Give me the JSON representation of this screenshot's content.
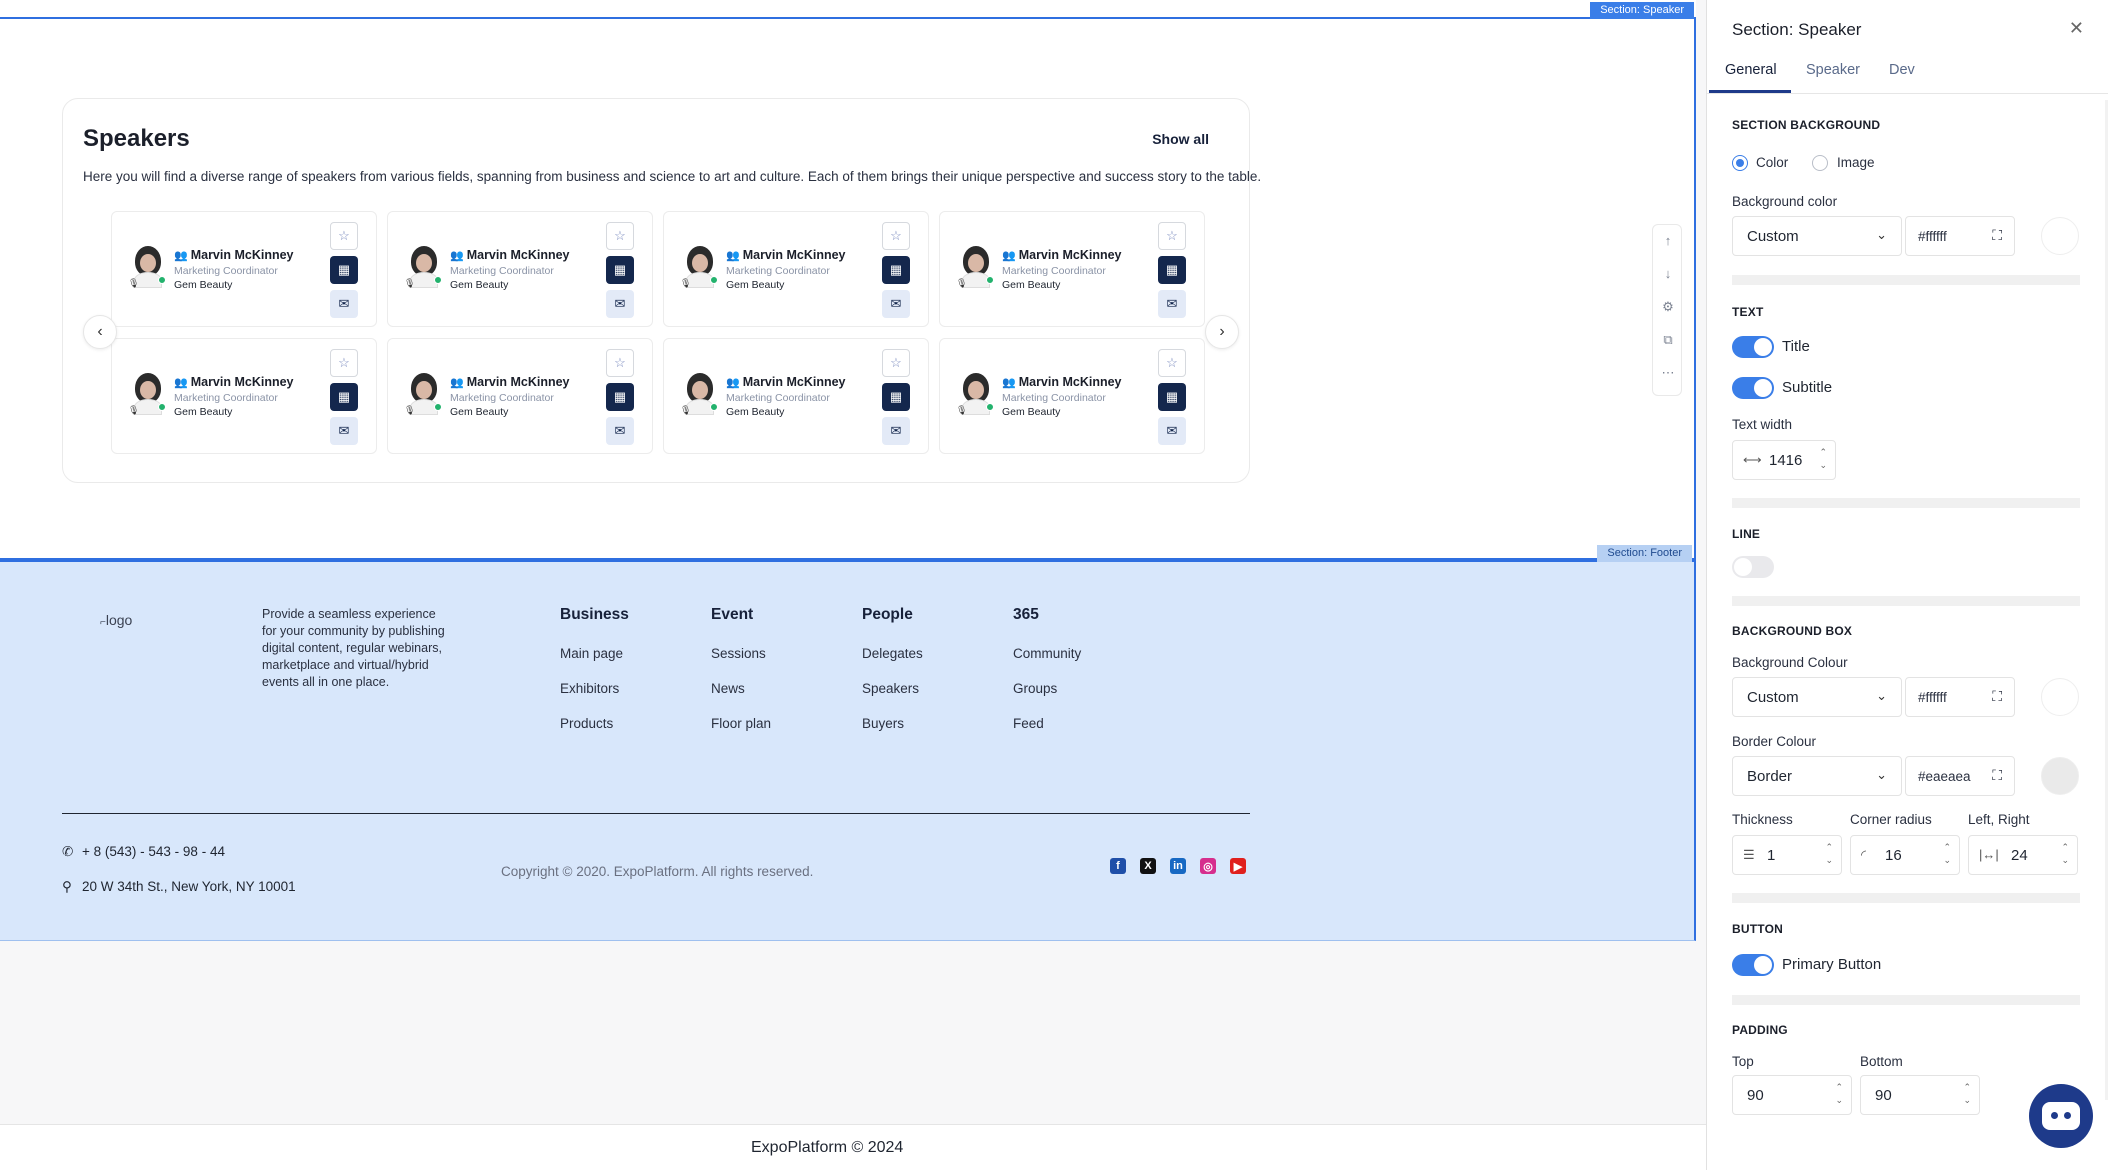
{
  "speakers_section": {
    "tag": "Section: Speaker",
    "title": "Speakers",
    "show_all": "Show all",
    "subtitle": "Here you will find a diverse range of speakers from various fields, spanning from business and science to art and culture. Each of them brings their unique perspective and success story to the table.",
    "cards": [
      {
        "name": "Marvin McKinney",
        "role": "Marketing Coordinator",
        "company": "Gem Beauty"
      },
      {
        "name": "Marvin McKinney",
        "role": "Marketing Coordinator",
        "company": "Gem Beauty"
      },
      {
        "name": "Marvin McKinney",
        "role": "Marketing Coordinator",
        "company": "Gem Beauty"
      },
      {
        "name": "Marvin McKinney",
        "role": "Marketing Coordinator",
        "company": "Gem Beauty"
      },
      {
        "name": "Marvin McKinney",
        "role": "Marketing Coordinator",
        "company": "Gem Beauty"
      },
      {
        "name": "Marvin McKinney",
        "role": "Marketing Coordinator",
        "company": "Gem Beauty"
      },
      {
        "name": "Marvin McKinney",
        "role": "Marketing Coordinator",
        "company": "Gem Beauty"
      },
      {
        "name": "Marvin McKinney",
        "role": "Marketing Coordinator",
        "company": "Gem Beauty"
      }
    ]
  },
  "footer_section": {
    "tag": "Section: Footer",
    "logo": "logo",
    "description": "Provide a seamless experience for your community by publishing digital content, regular webinars, marketplace and virtual/hybrid events all in one place.",
    "columns": [
      {
        "heading": "Business",
        "items": [
          "Main page",
          "Exhibitors",
          "Products"
        ]
      },
      {
        "heading": "Event",
        "items": [
          "Sessions",
          "News",
          "Floor plan"
        ]
      },
      {
        "heading": "People",
        "items": [
          "Delegates",
          "Speakers",
          "Buyers"
        ]
      },
      {
        "heading": "365",
        "items": [
          "Community",
          "Groups",
          "Feed"
        ]
      }
    ],
    "phone": "+ 8 (543) - 543 - 98 - 44",
    "address": "20 W 34th St., New York, NY 10001",
    "copyright": "Copyright © 2020. ExpoPlatform. All rights reserved.",
    "social": [
      "facebook-icon",
      "x-icon",
      "linkedin-icon",
      "instagram-icon",
      "youtube-icon"
    ]
  },
  "bottom_bar": {
    "text": "ExpoPlatform © 2024"
  },
  "panel": {
    "title": "Section: Speaker",
    "tabs": [
      "General",
      "Speaker",
      "Dev"
    ],
    "active_tab": "General",
    "section_background": {
      "heading": "SECTION BACKGROUND",
      "option_color": "Color",
      "option_image": "Image",
      "selected": "Color",
      "bg_color_label": "Background color",
      "bg_select": "Custom",
      "bg_hex": "#ffffff"
    },
    "text": {
      "heading": "TEXT",
      "title_toggle": "Title",
      "subtitle_toggle": "Subtitle",
      "width_label": "Text width",
      "width_value": "1416"
    },
    "line": {
      "heading": "LINE"
    },
    "background_box": {
      "heading": "BACKGROUND BOX",
      "bg_label": "Background Colour",
      "bg_select": "Custom",
      "bg_hex": "#ffffff",
      "border_label": "Border Colour",
      "border_select": "Border",
      "border_hex": "#eaeaea",
      "thickness_label": "Thickness",
      "thickness_value": "1",
      "radius_label": "Corner radius",
      "radius_value": "16",
      "lr_label": "Left, Right",
      "lr_value": "24"
    },
    "button": {
      "heading": "BUTTON",
      "primary_toggle": "Primary Button"
    },
    "padding": {
      "heading": "PADDING",
      "top_label": "Top",
      "top_value": "90",
      "bottom_label": "Bottom",
      "bottom_value": "90"
    }
  },
  "colors": {
    "accent": "#3a7ee8",
    "navy": "#14274d",
    "footer_bg": "#d8e7fb",
    "border_swatch": "#eaeaea"
  }
}
